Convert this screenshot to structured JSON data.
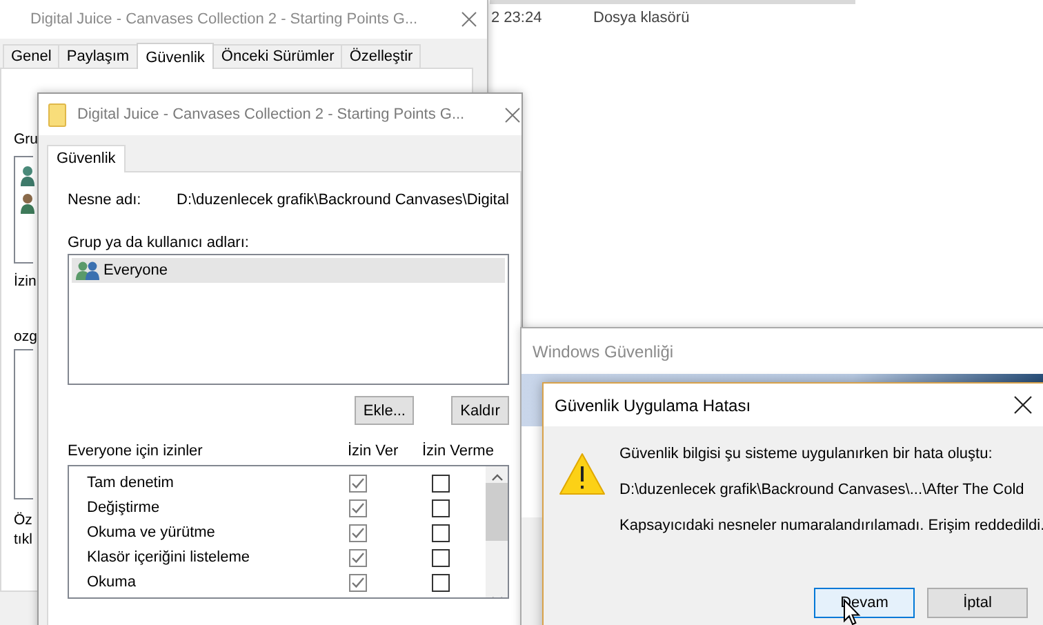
{
  "explorer_row": {
    "modified": "2 23:24",
    "type": "Dosya klasörü"
  },
  "properties_window": {
    "title": "Digital Juice - Canvases Collection 2 - Starting Points G...",
    "tabs": [
      {
        "label": "Genel",
        "selected": false
      },
      {
        "label": "Paylaşım",
        "selected": false
      },
      {
        "label": "Güvenlik",
        "selected": true
      },
      {
        "label": "Önceki Sürümler",
        "selected": false
      },
      {
        "label": "Özelleştir",
        "selected": false
      }
    ],
    "cut_texts": [
      "Gru",
      "İzin",
      "ozg",
      "Öz",
      "tıkl"
    ]
  },
  "security_window": {
    "title": "Digital Juice - Canvases Collection 2 - Starting Points G...",
    "tab": {
      "label": "Güvenlik",
      "selected": true
    },
    "object_label": "Nesne adı:",
    "object_path": "D:\\duzenlecek grafik\\Backround Canvases\\Digital",
    "group_label": "Grup ya da kullanıcı adları:",
    "users": [
      {
        "name": "Everyone",
        "selected": true
      }
    ],
    "buttons": [
      "Ekle...",
      "Kaldır"
    ],
    "permissions_header": "Everyone için izinler",
    "allow_header": "İzin Ver",
    "deny_header": "İzin Verme",
    "permissions": [
      {
        "name": "Tam denetim",
        "allow": true,
        "deny": false
      },
      {
        "name": "Değiştirme",
        "allow": true,
        "deny": false
      },
      {
        "name": "Okuma ve yürütme",
        "allow": true,
        "deny": false
      },
      {
        "name": "Klasör içeriğini listeleme",
        "allow": true,
        "deny": false
      },
      {
        "name": "Okuma",
        "allow": true,
        "deny": false
      }
    ]
  },
  "windows_security": {
    "title": "Windows Güvenliği"
  },
  "error_dialog": {
    "title": "Güvenlik Uygulama Hatası",
    "lines": [
      "Güvenlik bilgisi şu sisteme uygulanırken bir hata oluştu:",
      "D:\\duzenlecek grafik\\Backround Canvases\\...\\After The Cold",
      "Kapsayıcıdaki nesneler numaralandırılamadı. Erişim reddedildi."
    ],
    "buttons": [
      {
        "label": "Devam",
        "focused": true
      },
      {
        "label": "İptal",
        "focused": false
      }
    ]
  }
}
